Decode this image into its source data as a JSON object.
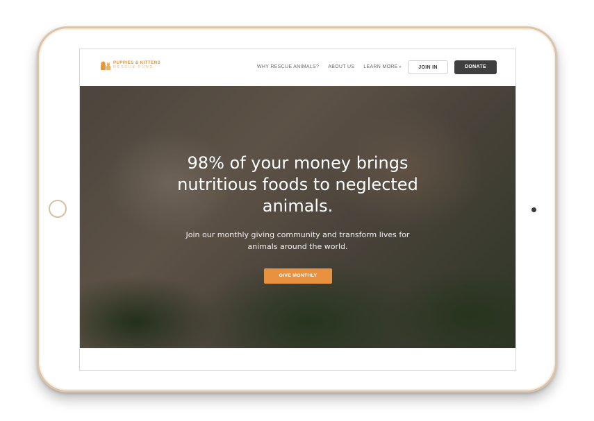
{
  "brand": {
    "name_line1": "PUPPIES & KITTENS",
    "name_line2": "RESCUE FUND",
    "accent": "#e8913f"
  },
  "nav": {
    "links": [
      "WHY RESCUE ANIMALS?",
      "ABOUT US",
      "LEARN MORE"
    ],
    "learn_more_caret": "▾",
    "join_label": "JOIN IN",
    "donate_label": "DONATE"
  },
  "hero": {
    "title": "98% of your money brings nutritious foods to neglected animals.",
    "subtitle": "Join our monthly giving community and transform lives for animals around the world.",
    "cta_label": "GIVE MONTHLY"
  },
  "icons": [
    "dog-cat-logo-icon",
    "chevron-down-icon"
  ]
}
